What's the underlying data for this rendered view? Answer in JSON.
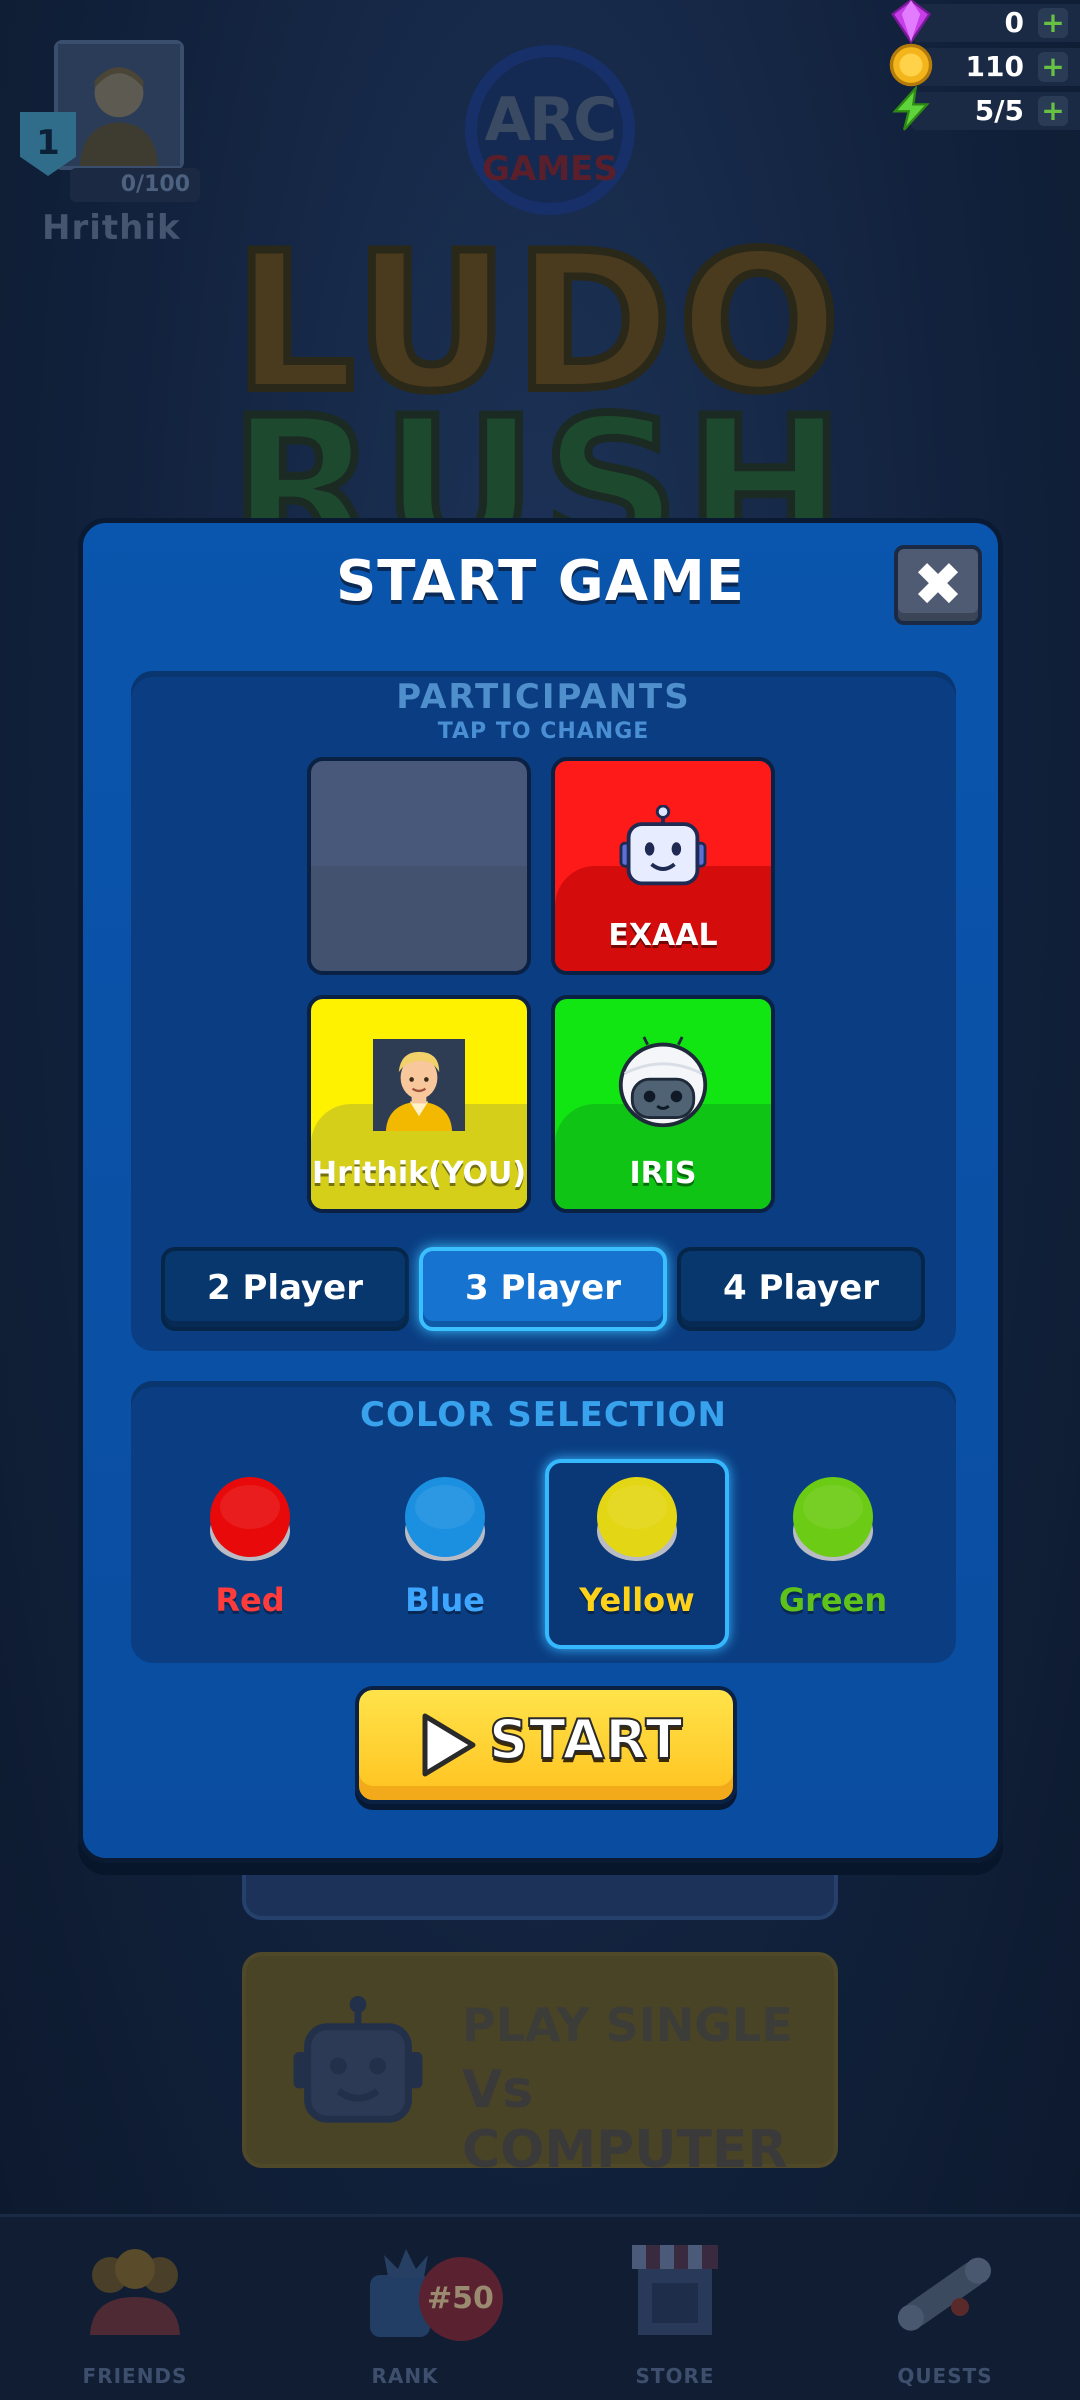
{
  "profile": {
    "level": "1",
    "xp": "0/100",
    "name": "Hrithik"
  },
  "currencies": [
    {
      "icon": "gem-icon",
      "value": "0"
    },
    {
      "icon": "coin-icon",
      "value": "110"
    },
    {
      "icon": "energy-icon",
      "value": "5/5"
    }
  ],
  "logo": {
    "line1": "ARC",
    "line2": "GAMES"
  },
  "game_title": {
    "line1": "LUDO",
    "line2": "RUSH"
  },
  "background_cards": {
    "friends_label": "",
    "single_line1": "PLAY SINGLE",
    "single_line2": "Vs COMPUTER"
  },
  "bottom_nav": [
    {
      "label": "FRIENDS",
      "icon": "friends-icon"
    },
    {
      "label": "RANK",
      "icon": "rank-icon",
      "badge": "#50"
    },
    {
      "label": "STORE",
      "icon": "store-icon"
    },
    {
      "label": "QUESTS",
      "icon": "quests-icon"
    }
  ],
  "modal": {
    "title": "START GAME",
    "close_icon": "close-icon",
    "participants": {
      "title": "PARTICIPANTS",
      "subtitle": "TAP TO CHANGE",
      "slots": [
        {
          "color": "empty",
          "name": ""
        },
        {
          "color": "red",
          "name": "EXAAL",
          "avatar": "robot-icon"
        },
        {
          "color": "yellow",
          "name": "Hrithik(YOU)",
          "avatar": "user-avatar"
        },
        {
          "color": "green",
          "name": "IRIS",
          "avatar": "astronaut-bot-icon"
        }
      ],
      "player_counts": [
        "2 Player",
        "3 Player",
        "4 Player"
      ],
      "selected_count": "3 Player"
    },
    "color_selection": {
      "title": "COLOR SELECTION",
      "options": [
        {
          "name": "Red",
          "color": "#e80a0a",
          "label_color": "#ff3b3b"
        },
        {
          "name": "Blue",
          "color": "#1b8fe0",
          "label_color": "#3ea6ff"
        },
        {
          "name": "Yellow",
          "color": "#e3d614",
          "label_color": "#ffd21a"
        },
        {
          "name": "Green",
          "color": "#6ccb14",
          "label_color": "#5ec21a"
        }
      ],
      "selected": "Yellow"
    },
    "start_label": "START"
  }
}
